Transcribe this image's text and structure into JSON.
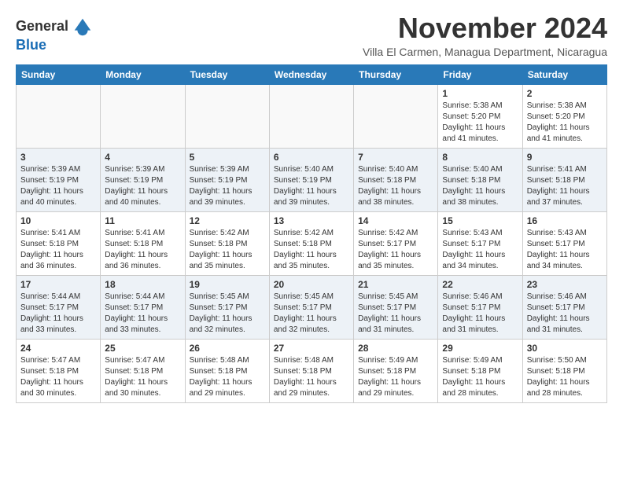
{
  "header": {
    "logo_line1": "General",
    "logo_line2": "Blue",
    "month_title": "November 2024",
    "subtitle": "Villa El Carmen, Managua Department, Nicaragua"
  },
  "days_of_week": [
    "Sunday",
    "Monday",
    "Tuesday",
    "Wednesday",
    "Thursday",
    "Friday",
    "Saturday"
  ],
  "weeks": [
    {
      "alt": false,
      "days": [
        {
          "num": "",
          "info": ""
        },
        {
          "num": "",
          "info": ""
        },
        {
          "num": "",
          "info": ""
        },
        {
          "num": "",
          "info": ""
        },
        {
          "num": "",
          "info": ""
        },
        {
          "num": "1",
          "info": "Sunrise: 5:38 AM\nSunset: 5:20 PM\nDaylight: 11 hours and 41 minutes."
        },
        {
          "num": "2",
          "info": "Sunrise: 5:38 AM\nSunset: 5:20 PM\nDaylight: 11 hours and 41 minutes."
        }
      ]
    },
    {
      "alt": true,
      "days": [
        {
          "num": "3",
          "info": "Sunrise: 5:39 AM\nSunset: 5:19 PM\nDaylight: 11 hours and 40 minutes."
        },
        {
          "num": "4",
          "info": "Sunrise: 5:39 AM\nSunset: 5:19 PM\nDaylight: 11 hours and 40 minutes."
        },
        {
          "num": "5",
          "info": "Sunrise: 5:39 AM\nSunset: 5:19 PM\nDaylight: 11 hours and 39 minutes."
        },
        {
          "num": "6",
          "info": "Sunrise: 5:40 AM\nSunset: 5:19 PM\nDaylight: 11 hours and 39 minutes."
        },
        {
          "num": "7",
          "info": "Sunrise: 5:40 AM\nSunset: 5:18 PM\nDaylight: 11 hours and 38 minutes."
        },
        {
          "num": "8",
          "info": "Sunrise: 5:40 AM\nSunset: 5:18 PM\nDaylight: 11 hours and 38 minutes."
        },
        {
          "num": "9",
          "info": "Sunrise: 5:41 AM\nSunset: 5:18 PM\nDaylight: 11 hours and 37 minutes."
        }
      ]
    },
    {
      "alt": false,
      "days": [
        {
          "num": "10",
          "info": "Sunrise: 5:41 AM\nSunset: 5:18 PM\nDaylight: 11 hours and 36 minutes."
        },
        {
          "num": "11",
          "info": "Sunrise: 5:41 AM\nSunset: 5:18 PM\nDaylight: 11 hours and 36 minutes."
        },
        {
          "num": "12",
          "info": "Sunrise: 5:42 AM\nSunset: 5:18 PM\nDaylight: 11 hours and 35 minutes."
        },
        {
          "num": "13",
          "info": "Sunrise: 5:42 AM\nSunset: 5:18 PM\nDaylight: 11 hours and 35 minutes."
        },
        {
          "num": "14",
          "info": "Sunrise: 5:42 AM\nSunset: 5:17 PM\nDaylight: 11 hours and 35 minutes."
        },
        {
          "num": "15",
          "info": "Sunrise: 5:43 AM\nSunset: 5:17 PM\nDaylight: 11 hours and 34 minutes."
        },
        {
          "num": "16",
          "info": "Sunrise: 5:43 AM\nSunset: 5:17 PM\nDaylight: 11 hours and 34 minutes."
        }
      ]
    },
    {
      "alt": true,
      "days": [
        {
          "num": "17",
          "info": "Sunrise: 5:44 AM\nSunset: 5:17 PM\nDaylight: 11 hours and 33 minutes."
        },
        {
          "num": "18",
          "info": "Sunrise: 5:44 AM\nSunset: 5:17 PM\nDaylight: 11 hours and 33 minutes."
        },
        {
          "num": "19",
          "info": "Sunrise: 5:45 AM\nSunset: 5:17 PM\nDaylight: 11 hours and 32 minutes."
        },
        {
          "num": "20",
          "info": "Sunrise: 5:45 AM\nSunset: 5:17 PM\nDaylight: 11 hours and 32 minutes."
        },
        {
          "num": "21",
          "info": "Sunrise: 5:45 AM\nSunset: 5:17 PM\nDaylight: 11 hours and 31 minutes."
        },
        {
          "num": "22",
          "info": "Sunrise: 5:46 AM\nSunset: 5:17 PM\nDaylight: 11 hours and 31 minutes."
        },
        {
          "num": "23",
          "info": "Sunrise: 5:46 AM\nSunset: 5:17 PM\nDaylight: 11 hours and 31 minutes."
        }
      ]
    },
    {
      "alt": false,
      "days": [
        {
          "num": "24",
          "info": "Sunrise: 5:47 AM\nSunset: 5:18 PM\nDaylight: 11 hours and 30 minutes."
        },
        {
          "num": "25",
          "info": "Sunrise: 5:47 AM\nSunset: 5:18 PM\nDaylight: 11 hours and 30 minutes."
        },
        {
          "num": "26",
          "info": "Sunrise: 5:48 AM\nSunset: 5:18 PM\nDaylight: 11 hours and 29 minutes."
        },
        {
          "num": "27",
          "info": "Sunrise: 5:48 AM\nSunset: 5:18 PM\nDaylight: 11 hours and 29 minutes."
        },
        {
          "num": "28",
          "info": "Sunrise: 5:49 AM\nSunset: 5:18 PM\nDaylight: 11 hours and 29 minutes."
        },
        {
          "num": "29",
          "info": "Sunrise: 5:49 AM\nSunset: 5:18 PM\nDaylight: 11 hours and 28 minutes."
        },
        {
          "num": "30",
          "info": "Sunrise: 5:50 AM\nSunset: 5:18 PM\nDaylight: 11 hours and 28 minutes."
        }
      ]
    }
  ]
}
